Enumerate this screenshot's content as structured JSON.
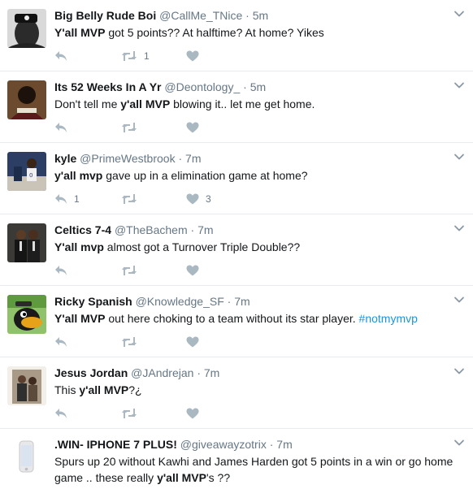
{
  "colors": {
    "link": "#1b95e0",
    "muted": "#8899a6",
    "text": "#14171a",
    "border": "#e6ecf0"
  },
  "icons": {
    "reply": "reply-icon",
    "retweet": "retweet-icon",
    "like": "heart-icon",
    "more": "chevron-down-icon"
  },
  "tweets": [
    {
      "name": "Big Belly Rude Boi",
      "handle": "@CallMe_TNice",
      "dot": "·",
      "time": "5m",
      "body": [
        {
          "t": "Y'all MVP",
          "b": true
        },
        {
          "t": " got 5 points?? At halftime? At home? Yikes"
        }
      ],
      "reply_count": "",
      "retweet_count": "1",
      "like_count": ""
    },
    {
      "name": "Its 52 Weeks In A Yr",
      "handle": "@Deontology_",
      "dot": "·",
      "time": "5m",
      "body": [
        {
          "t": "Don't tell me "
        },
        {
          "t": "y'all MVP",
          "b": true
        },
        {
          "t": " blowing it.. let me get home."
        }
      ],
      "reply_count": "",
      "retweet_count": "",
      "like_count": ""
    },
    {
      "name": "kyle",
      "handle": "@PrimeWestbrook",
      "dot": "·",
      "time": "7m",
      "body": [
        {
          "t": "y'all mvp",
          "b": true
        },
        {
          "t": " gave up in a elimination game at home?"
        }
      ],
      "reply_count": "1",
      "retweet_count": "",
      "like_count": "3"
    },
    {
      "name": "Celtics 7-4",
      "handle": "@TheBachem",
      "dot": "·",
      "time": "7m",
      "body": [
        {
          "t": "Y'all mvp",
          "b": true
        },
        {
          "t": " almost got a Turnover Triple Double??"
        }
      ],
      "reply_count": "",
      "retweet_count": "",
      "like_count": ""
    },
    {
      "name": "Ricky Spanish",
      "handle": "@Knowledge_SF",
      "dot": "·",
      "time": "7m",
      "body": [
        {
          "t": "Y'all MVP",
          "b": true
        },
        {
          "t": " out here choking to a team without its star player. "
        },
        {
          "t": "#notmymvp",
          "h": true
        }
      ],
      "reply_count": "",
      "retweet_count": "",
      "like_count": ""
    },
    {
      "name": "Jesus Jordan",
      "handle": "@JAndrejan",
      "dot": "·",
      "time": "7m",
      "body": [
        {
          "t": "This "
        },
        {
          "t": "y'all MVP",
          "b": true
        },
        {
          "t": "?¿"
        }
      ],
      "reply_count": "",
      "retweet_count": "",
      "like_count": ""
    },
    {
      "name": ".WIN- IPHONE 7 PLUS!",
      "handle": "@giveawayzotrix",
      "dot": "·",
      "time": "7m",
      "body": [
        {
          "t": "Spurs up 20 without Kawhi and James Harden got 5 points in a win or go home game .. these really "
        },
        {
          "t": "y'all MVP",
          "b": true
        },
        {
          "t": "'s ??"
        }
      ],
      "reply_count": "",
      "retweet_count": "",
      "like_count": ""
    }
  ]
}
